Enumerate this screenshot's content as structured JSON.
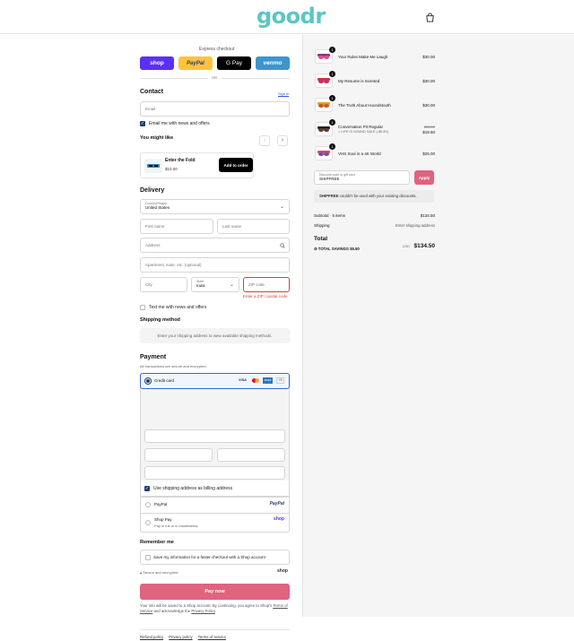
{
  "header": {
    "logo": "goodr",
    "cart_icon": "bag-icon"
  },
  "express": {
    "label": "Express checkout",
    "or": "OR",
    "buttons": [
      {
        "label": "shop",
        "color": "#5a31f4"
      },
      {
        "label": "PayPal",
        "color": "#ffc439"
      },
      {
        "label": "G Pay",
        "color": "#000000"
      },
      {
        "label": "venmo",
        "color": "#3d95ce"
      }
    ]
  },
  "contact": {
    "title": "Contact",
    "signin": "Sign in",
    "email_placeholder": "Email",
    "news_label": "Email me with news and offers"
  },
  "upsell": {
    "title": "You might like",
    "product_name": "Enter the Fold",
    "product_price": "$10.00",
    "add_button": "Add to order"
  },
  "delivery": {
    "title": "Delivery",
    "country_label": "Country/Region",
    "country_value": "United States",
    "first_name": "First name",
    "last_name": "Last name",
    "address": "Address",
    "apartment": "Apartment, suite, etc. (optional)",
    "city": "City",
    "state_label": "State",
    "state_value": "Iowa",
    "zip": "ZIP code",
    "zip_error": "Enter a ZIP / postal code",
    "text_me": "Text me with news and offers"
  },
  "shipping": {
    "title": "Shipping method",
    "message": "Enter your shipping address to view available shipping methods."
  },
  "payment": {
    "title": "Payment",
    "subtitle": "All transactions are secure and encrypted.",
    "credit_card": "Credit card",
    "card_brands": [
      "VISA",
      "MC",
      "AMEX",
      "+3"
    ],
    "billing_label": "Use shipping address as billing address",
    "paypal": "PayPal",
    "paypal_logo": "PayPal",
    "shoppay": "Shop Pay",
    "shoppay_sub": "Pay in full or in installments",
    "shoppay_logo": "shop"
  },
  "remember": {
    "title": "Remember me",
    "label": "Save my information for a faster checkout with a Shop account",
    "secure": "Secure and encrypted",
    "shop_logo": "shop"
  },
  "pay": {
    "button": "Pay now",
    "note_1": "Your info will be saved to a Shop account. By continuing, you agree to Shop's",
    "terms": "Terms of Service",
    "note_2": "and acknowledge the",
    "privacy": "Privacy Policy",
    "note_end": "."
  },
  "footer_links": [
    "Refund policy",
    "Privacy policy",
    "Terms of service"
  ],
  "cart": {
    "items": [
      {
        "qty": "1",
        "name": "Your Rules Make Me Laugh",
        "price": "$30.00",
        "colors": [
          "#9b2a8a",
          "#e14d8f"
        ]
      },
      {
        "qty": "1",
        "name": "My Resume is Scented",
        "price": "$30.00",
        "colors": [
          "#d3312f",
          "#c72c5d"
        ]
      },
      {
        "qty": "1",
        "name": "The Truth About Houndstooth",
        "price": "$30.00",
        "colors": [
          "#f29a23",
          "#c25b1e"
        ]
      },
      {
        "qty": "1",
        "name": "Conversation Pit Regular",
        "old_price": "$25.00",
        "price": "$19.50",
        "discount": "LIFE IS SOUND SALE (-$5.50)",
        "colors": [
          "#222222",
          "#5a3c2c"
        ]
      },
      {
        "qty": "1",
        "name": "VHS Soul in a 4K World",
        "price": "$25.00",
        "colors": [
          "#d94a63",
          "#7a4da0"
        ]
      }
    ],
    "discount_label": "Discount code or gift card",
    "discount_value": "SHIPFREE",
    "apply": "Apply",
    "notice_code": "SHIPFREE",
    "notice_text": "couldn't be used with your existing discounts.",
    "subtotal_label": "Subtotal · 5 items",
    "subtotal_value": "$134.50",
    "shipping_label": "Shipping",
    "shipping_value": "Enter shipping address",
    "total_label": "Total",
    "currency": "USD",
    "total_value": "$134.50",
    "savings_label": "TOTAL SAVINGS",
    "savings_value": "$5.50"
  },
  "colors": {
    "accent": "#e0637f",
    "brand": "#5bc6c3",
    "error": "#d9403c",
    "nav": "#1f3e6e"
  }
}
